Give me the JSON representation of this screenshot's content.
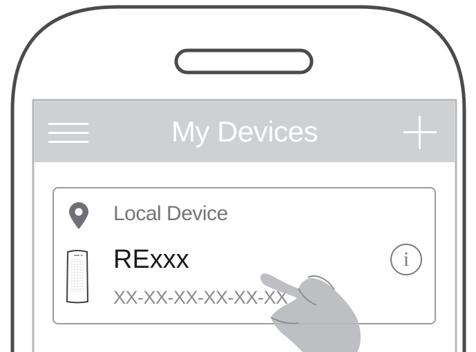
{
  "header": {
    "title": "My Devices",
    "menu_icon": "hamburger-menu-icon",
    "add_icon": "plus-icon"
  },
  "device_card": {
    "section_label": "Local Device",
    "location_icon": "location-pin-icon",
    "device_name": "RExxx",
    "device_mac": "XX-XX-XX-XX-XX-XX",
    "info_icon": "info-icon",
    "info_glyph": "i"
  },
  "colors": {
    "header_bg": "#cfd0d2",
    "header_text": "#ffffff",
    "card_border": "#9a9b9e",
    "pin": "#6f7073",
    "phone_outline": "#4a4b4e"
  }
}
